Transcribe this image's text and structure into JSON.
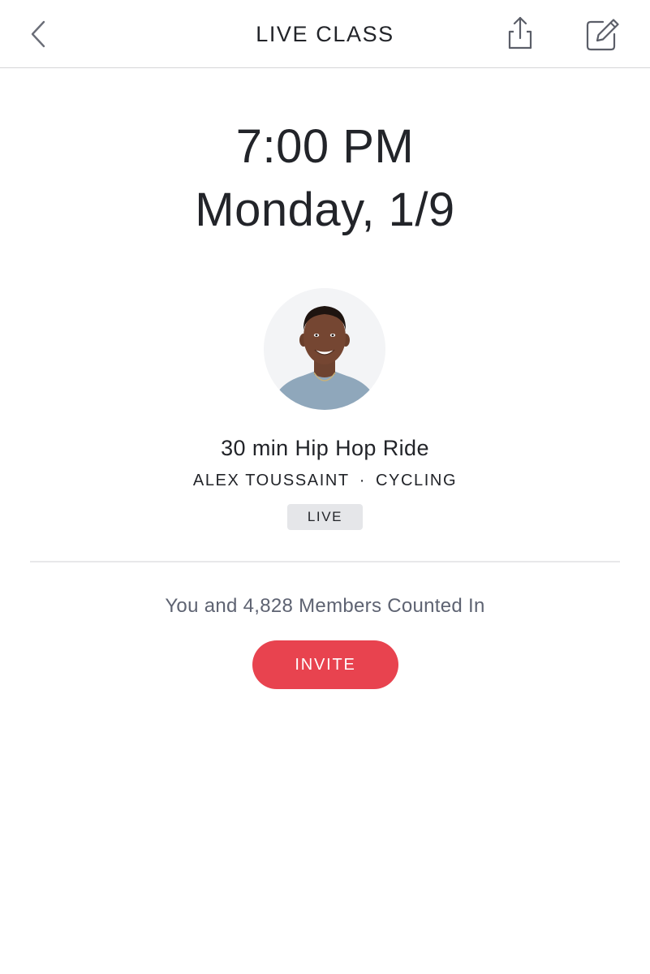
{
  "header": {
    "title": "LIVE CLASS",
    "back_icon": "chevron-left-icon",
    "share_icon": "share-icon",
    "edit_icon": "compose-icon"
  },
  "schedule": {
    "time": "7:00 PM",
    "date": "Monday, 1/9"
  },
  "class_info": {
    "title": "30 min Hip Hop Ride",
    "instructor": "ALEX TOUSSAINT",
    "separator": "·",
    "discipline": "CYCLING",
    "badge": "LIVE"
  },
  "attendance": {
    "text": "You and 4,828 Members Counted In"
  },
  "actions": {
    "invite_label": "INVITE"
  },
  "colors": {
    "accent": "#e8434f",
    "badge_bg": "#e5e6e9",
    "muted_text": "#5e6372",
    "primary_text": "#222429"
  }
}
